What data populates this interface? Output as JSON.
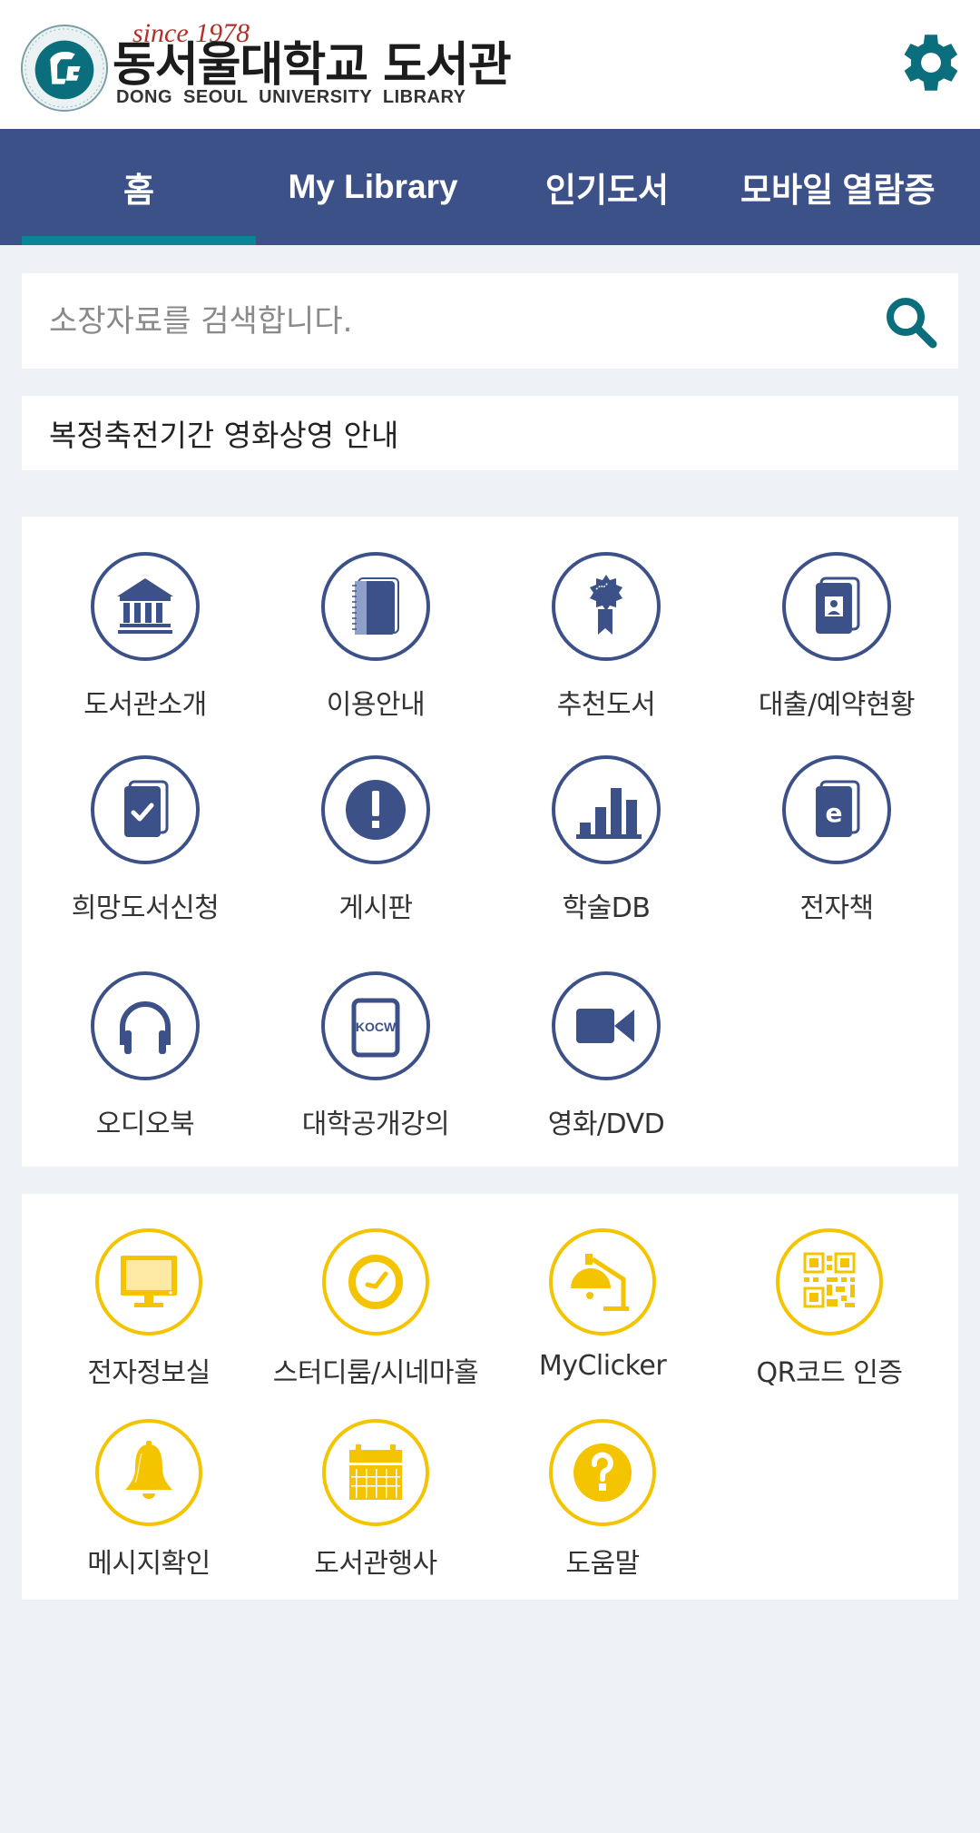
{
  "header": {
    "logo": {
      "since": "since 1978",
      "title_ko": "동서울대학교 도서관",
      "title_en": "DONG SEOUL UNIVERSITY   LIBRARY",
      "emblem_icon": "university-emblem-icon"
    },
    "settings_icon": "gear-icon"
  },
  "nav": {
    "active_index": 0,
    "tabs": [
      {
        "label": "홈"
      },
      {
        "label": "My Library"
      },
      {
        "label": "인기도서"
      },
      {
        "label": "모바일 열람증"
      }
    ]
  },
  "search": {
    "value": "",
    "placeholder": "소장자료를 검색합니다.",
    "button_icon": "search-icon"
  },
  "notice": {
    "text": "복정축전기간 영화상영 안내"
  },
  "menu_primary": {
    "color": "#3d5189",
    "items": [
      {
        "label": "도서관소개",
        "icon": "library-building-icon"
      },
      {
        "label": "이용안내",
        "icon": "notebook-icon"
      },
      {
        "label": "추천도서",
        "icon": "award-ribbon-icon"
      },
      {
        "label": "대출/예약현황",
        "icon": "user-book-icon"
      },
      {
        "label": "희망도서신청",
        "icon": "book-check-icon"
      },
      {
        "label": "게시판",
        "icon": "exclamation-icon"
      },
      {
        "label": "학술DB",
        "icon": "bar-chart-icon"
      },
      {
        "label": "전자책",
        "icon": "ebook-icon"
      },
      {
        "label": "오디오북",
        "icon": "headphones-icon"
      },
      {
        "label": "대학공개강의",
        "icon": "kocw-icon",
        "icon_text": "KOCW"
      },
      {
        "label": "영화/DVD",
        "icon": "video-camera-icon"
      }
    ]
  },
  "menu_secondary": {
    "color": "#f5c400",
    "items": [
      {
        "label": "전자정보실",
        "icon": "monitor-icon"
      },
      {
        "label": "스터디룸/시네마홀",
        "icon": "clock-icon"
      },
      {
        "label": "MyClicker",
        "icon": "desk-lamp-icon"
      },
      {
        "label": "QR코드 인증",
        "icon": "qr-code-icon"
      },
      {
        "label": "메시지확인",
        "icon": "bell-icon"
      },
      {
        "label": "도서관행사",
        "icon": "calendar-icon"
      },
      {
        "label": "도움말",
        "icon": "help-icon"
      }
    ]
  },
  "colors": {
    "nav_bg": "#3d5189",
    "accent_teal": "#0a6e7c",
    "tab_indicator": "#0a8595",
    "page_bg": "#eef1f6",
    "primary_icon": "#3d5189",
    "secondary_icon": "#f5c400"
  }
}
